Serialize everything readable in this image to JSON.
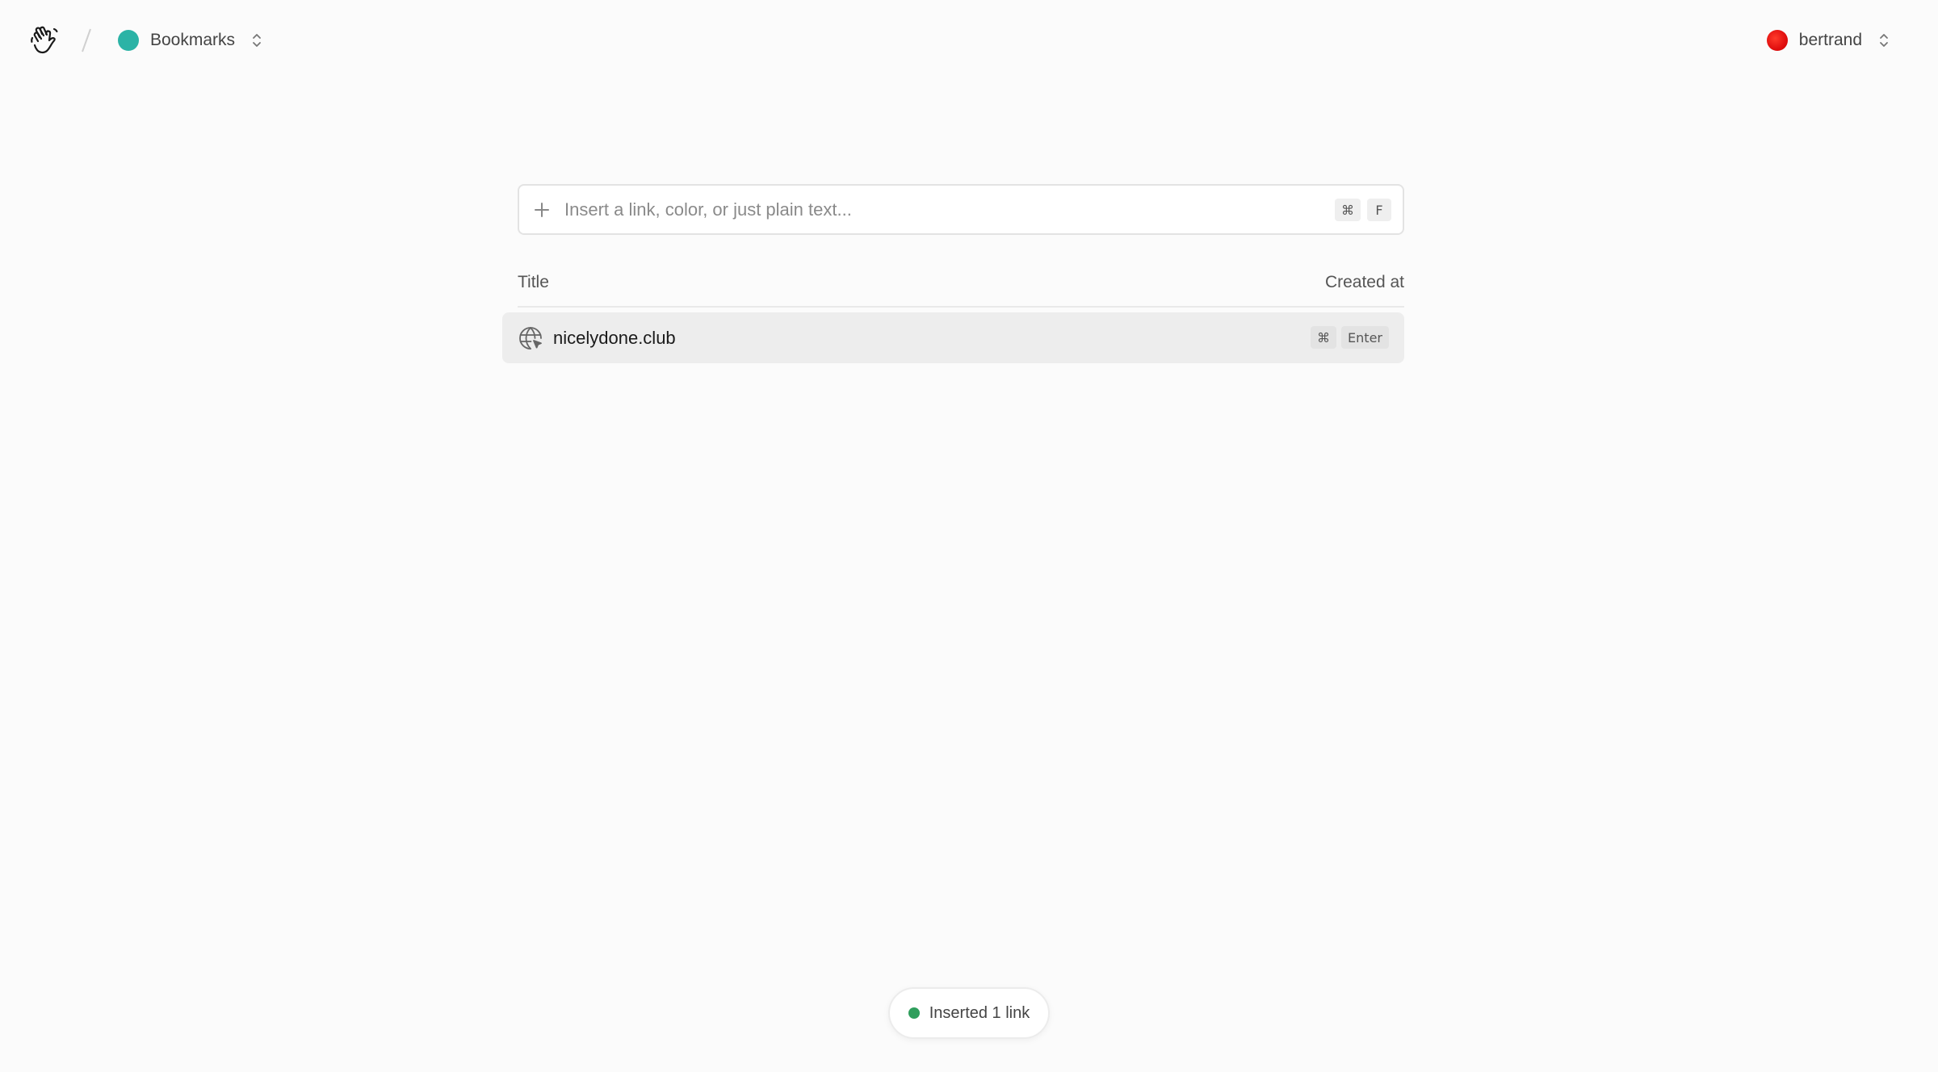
{
  "header": {
    "logo_icon": "waving-hand-icon",
    "space": {
      "label": "Bookmarks",
      "dot_color": "#2bb3a6",
      "chevron_icon": "chevron-updown-icon"
    },
    "user": {
      "label": "bertrand",
      "avatar_color": "#e10f0f",
      "chevron_icon": "chevron-updown-icon"
    }
  },
  "input": {
    "placeholder": "Insert a link, color, or just plain text...",
    "value": "",
    "icon": "plus-icon",
    "shortcut": [
      "⌘",
      "F"
    ]
  },
  "table": {
    "columns": [
      "Title",
      "Created at"
    ],
    "rows": [
      {
        "icon": "globe-icon",
        "title": "nicelydone.club",
        "shortcut": [
          "⌘",
          "Enter"
        ]
      }
    ]
  },
  "toast": {
    "label": "Inserted 1 link",
    "dot_color": "#2f9e5c"
  }
}
